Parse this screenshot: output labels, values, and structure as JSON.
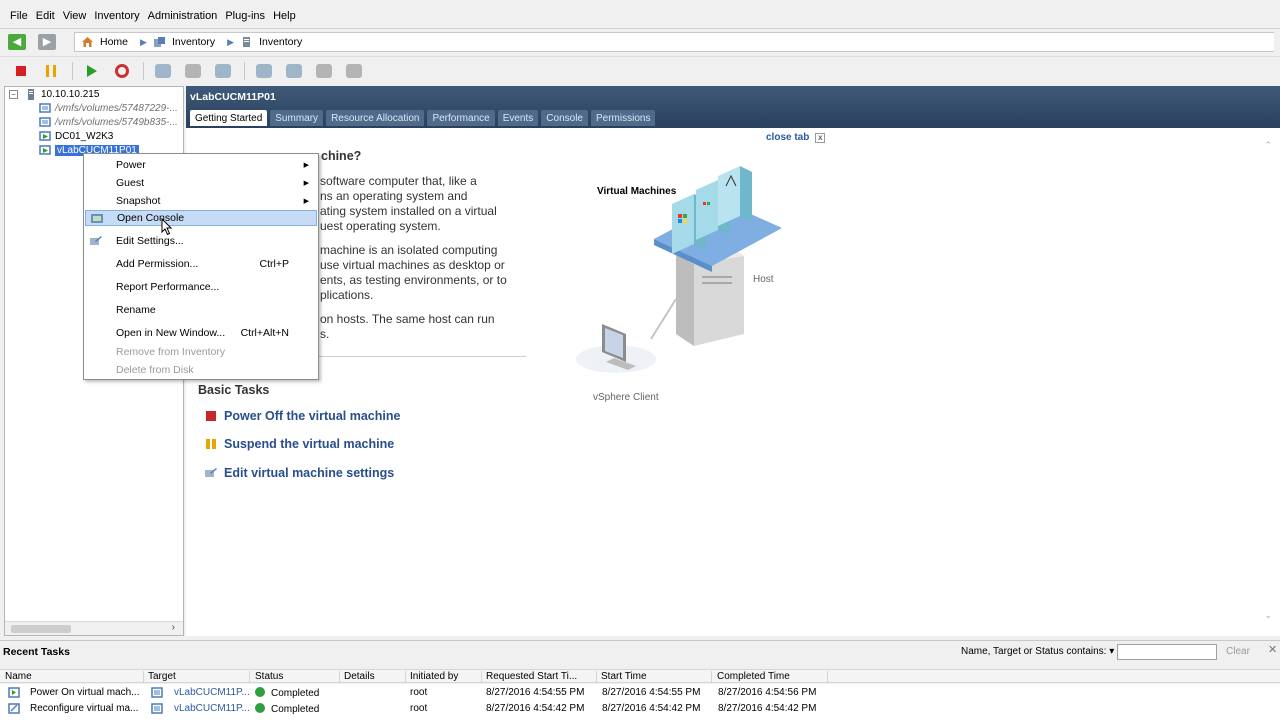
{
  "menu": [
    "File",
    "Edit",
    "View",
    "Inventory",
    "Administration",
    "Plug-ins",
    "Help"
  ],
  "breadcrumb": [
    "Home",
    "Inventory",
    "Inventory"
  ],
  "tree": {
    "host": "10.10.10.215",
    "items": [
      "/vmfs/volumes/57487229-...",
      "/vmfs/volumes/5749b835-...",
      "DC01_W2K3",
      "vLabCUCM11P01"
    ]
  },
  "main": {
    "title": "vLabCUCM11P01",
    "tabs": [
      "Getting Started",
      "Summary",
      "Resource Allocation",
      "Performance",
      "Events",
      "Console",
      "Permissions"
    ],
    "close_tab": "close tab",
    "heading": "chine?",
    "para1": [
      "software computer that, like a",
      "ns an operating system and",
      "ating system installed on a virtual",
      "uest operating system."
    ],
    "para2": [
      "machine is an isolated computing",
      "use virtual machines as desktop or",
      "ents, as testing environments, or to",
      "plications."
    ],
    "para3": [
      "on hosts. The same host can run",
      "s."
    ],
    "basic_tasks_title": "Basic Tasks",
    "tasks": [
      "Power Off the virtual machine",
      "Suspend the virtual machine",
      "Edit virtual machine settings"
    ],
    "diagram": {
      "vms_label": "Virtual Machines",
      "host_label": "Host",
      "client_label": "vSphere Client"
    }
  },
  "context_menu": {
    "items": [
      {
        "label": "Power",
        "submenu": true
      },
      {
        "label": "Guest",
        "submenu": true
      },
      {
        "label": "Snapshot",
        "submenu": true
      },
      {
        "label": "Open Console",
        "highlighted": true
      },
      {
        "label": "Edit Settings..."
      },
      {
        "label": "Add Permission...",
        "shortcut": "Ctrl+P"
      },
      {
        "label": "Report Performance..."
      },
      {
        "label": "Rename"
      },
      {
        "label": "Open in New Window...",
        "shortcut": "Ctrl+Alt+N"
      },
      {
        "label": "Remove from Inventory",
        "disabled": true
      },
      {
        "label": "Delete from Disk",
        "disabled": true
      }
    ]
  },
  "recent_tasks": {
    "title": "Recent Tasks",
    "filter_label": "Name, Target or Status contains: ▾",
    "filter_value": "",
    "clear_label": "Clear",
    "close_glyph": "✕",
    "columns": [
      "Name",
      "Target",
      "Status",
      "Details",
      "Initiated by",
      "Requested Start Ti...",
      "Start Time",
      "Completed Time"
    ],
    "rows": [
      {
        "name": "Power On virtual mach...",
        "target": "vLabCUCM11P...",
        "status": "Completed",
        "details": "",
        "initiated_by": "root",
        "requested": "8/27/2016 4:54:55 PM",
        "start": "8/27/2016 4:54:55 PM",
        "completed": "8/27/2016 4:54:56 PM"
      },
      {
        "name": "Reconfigure virtual ma...",
        "target": "vLabCUCM11P...",
        "status": "Completed",
        "details": "",
        "initiated_by": "root",
        "requested": "8/27/2016 4:54:42 PM",
        "start": "8/27/2016 4:54:42 PM",
        "completed": "8/27/2016 4:54:42 PM"
      }
    ]
  },
  "colors": {
    "header_bg": "#2f4866",
    "link": "#284e8c",
    "menu_highlight": "#c6dbf5",
    "selected": "#3874d8"
  }
}
